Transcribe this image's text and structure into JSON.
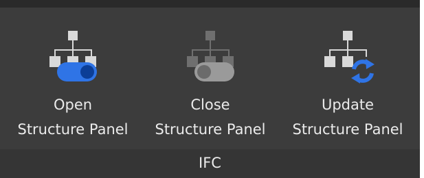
{
  "ribbon": {
    "buttons": [
      {
        "line1": "Open",
        "line2": "Structure Panel",
        "icon": "structure-tree-toggle-on-icon"
      },
      {
        "line1": "Close",
        "line2": "Structure Panel",
        "icon": "structure-tree-toggle-off-icon"
      },
      {
        "line1": "Update",
        "line2": "Structure Panel",
        "icon": "structure-tree-refresh-icon"
      }
    ],
    "group_label": "IFC"
  },
  "colors": {
    "panel_bg": "#3c3c3c",
    "accent_blue": "#2f74e6",
    "disabled_gray": "#8a8a8a"
  }
}
